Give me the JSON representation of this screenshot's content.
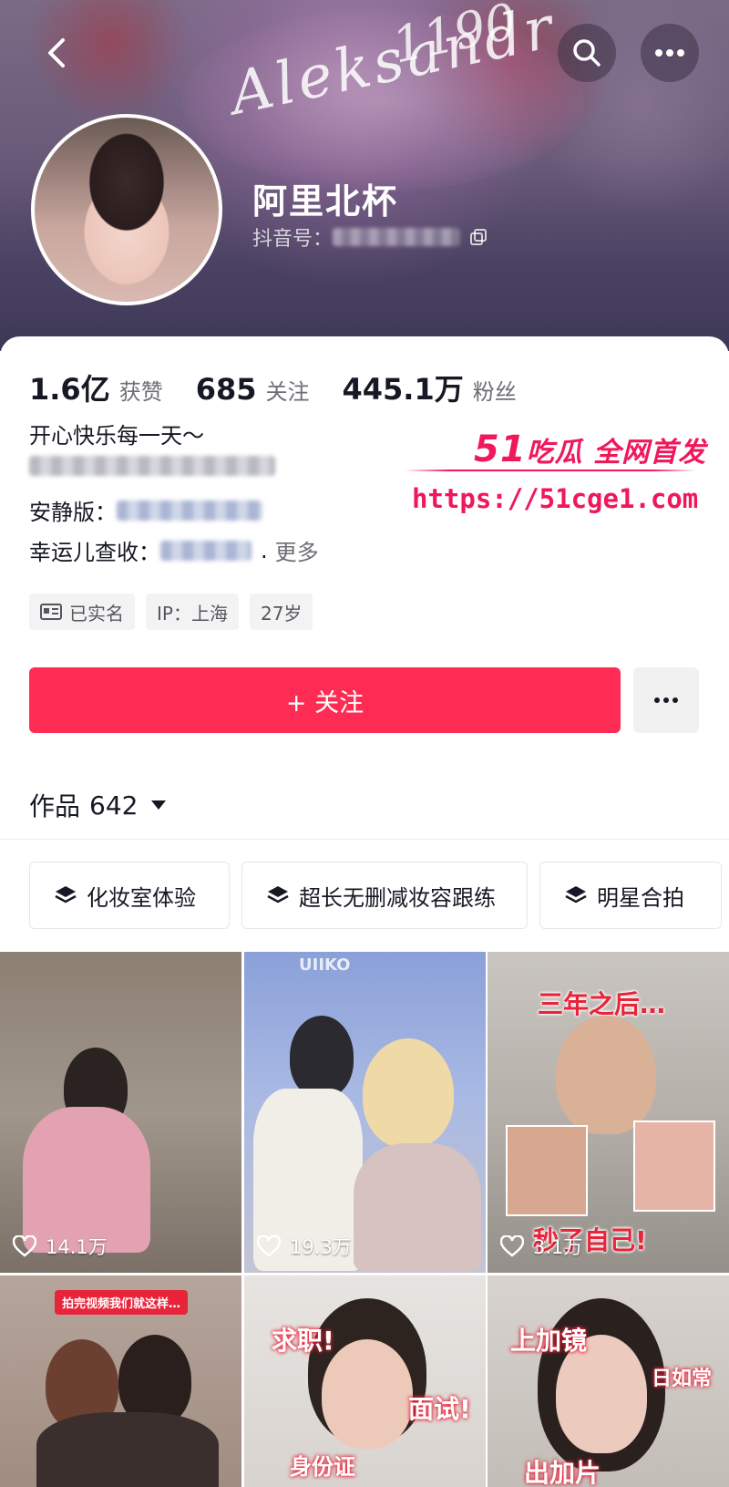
{
  "header": {
    "cover_text_1": "Aleksandr",
    "cover_text_2": "1190",
    "nickname": "阿里北杯",
    "douyin_id_label": "抖音号："
  },
  "stats": [
    {
      "num": "1.6亿",
      "label": "获赞"
    },
    {
      "num": "685",
      "label": "关注"
    },
    {
      "num": "445.1万",
      "label": "粉丝"
    }
  ],
  "bio": {
    "line1": "开心快乐每一天～",
    "line3_label": "安静版：",
    "line4_label": "幸运儿查收：",
    "line4_suffix": ".",
    "more": "更多"
  },
  "tags": {
    "verified": "已实名",
    "ip": "IP：上海",
    "age": "27岁"
  },
  "actions": {
    "follow": "+ 关注"
  },
  "works": {
    "label": "作品",
    "count": "642"
  },
  "collections": [
    "化妆室体验",
    "超长无删减妆容跟练",
    "明星合拍"
  ],
  "videos": [
    {
      "likes": "14.1万"
    },
    {
      "likes": "19.3万",
      "sign": "UIIKO"
    },
    {
      "likes": "3.1万",
      "caption_top": "三年之后…",
      "caption_bottom": "秒了自己!"
    },
    {
      "caption": "拍完视频我们就这样…"
    },
    {
      "caption_a": "求职!",
      "caption_b": "面试!",
      "caption_c": "身份证"
    },
    {
      "caption_a": "上加镜",
      "caption_b": "日如常",
      "caption_c": "出加片"
    }
  ],
  "watermark": {
    "title_num": "51",
    "title": "吃瓜 全网首发",
    "url": "https://51cge1.com"
  }
}
